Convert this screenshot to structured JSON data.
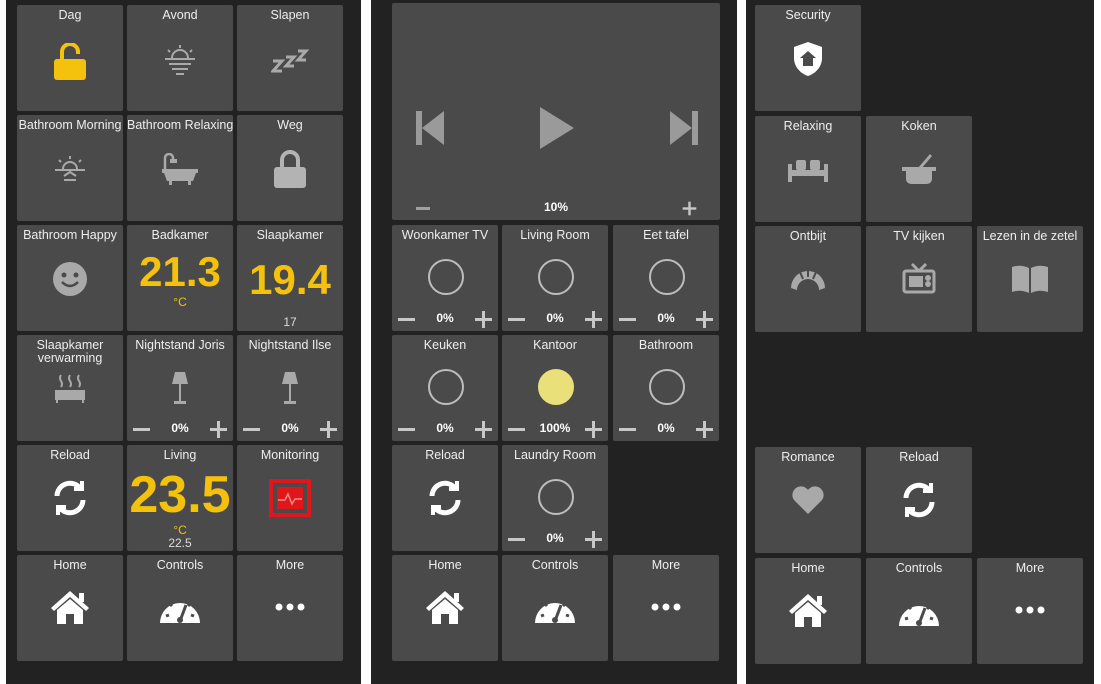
{
  "colors": {
    "accent": "#f4c20d",
    "alert": "#e0171a",
    "bulb_on": "#e9e07a",
    "tile": "#4a4a4a",
    "panel": "#222222"
  },
  "panel1": {
    "tiles": [
      {
        "label": "Dag",
        "icon": "unlock-icon"
      },
      {
        "label": "Avond",
        "icon": "sunset-icon"
      },
      {
        "label": "Slapen",
        "icon": "sleep-zzz-icon"
      },
      {
        "label": "Bathroom Morning",
        "icon": "sunrise-icon"
      },
      {
        "label": "Bathroom Relaxing",
        "icon": "bathtub-icon"
      },
      {
        "label": "Weg",
        "icon": "lock-icon"
      },
      {
        "label": "Bathroom Happy",
        "icon": "smiley-icon"
      },
      {
        "label": "Badkamer",
        "value": "21.3",
        "unit": "°C"
      },
      {
        "label": "Slaapkamer",
        "value": "19.4",
        "sub": "17"
      },
      {
        "label": "Slaapkamer verwarming",
        "icon": "radiator-icon"
      },
      {
        "label": "Nightstand Joris",
        "icon": "lamp-icon",
        "level": "0%"
      },
      {
        "label": "Nightstand Ilse",
        "icon": "lamp-icon",
        "level": "0%"
      },
      {
        "label": "Reload",
        "icon": "reload-icon"
      },
      {
        "label": "Living",
        "value": "23.5",
        "unit": "°C",
        "sub": "22.5"
      },
      {
        "label": "Monitoring",
        "icon": "monitoring-icon"
      },
      {
        "label": "Home",
        "icon": "home-icon"
      },
      {
        "label": "Controls",
        "icon": "gauge-icon"
      },
      {
        "label": "More",
        "icon": "more-icon"
      }
    ]
  },
  "panel2": {
    "media": {
      "volume": "10%"
    },
    "tiles": [
      {
        "label": "Woonkamer TV",
        "level": "0%"
      },
      {
        "label": "Living Room",
        "level": "0%"
      },
      {
        "label": "Eet tafel",
        "level": "0%"
      },
      {
        "label": "Keuken",
        "level": "0%"
      },
      {
        "label": "Kantoor",
        "level": "100%"
      },
      {
        "label": "Bathroom",
        "level": "0%"
      },
      {
        "label": "Reload",
        "icon": "reload-icon"
      },
      {
        "label": "Laundry Room",
        "level": "0%"
      },
      {
        "label": "Home",
        "icon": "home-icon"
      },
      {
        "label": "Controls",
        "icon": "gauge-icon"
      },
      {
        "label": "More",
        "icon": "more-icon"
      }
    ]
  },
  "panel3": {
    "tiles": [
      {
        "label": "Security",
        "icon": "shield-home-icon"
      },
      {
        "label": "Relaxing",
        "icon": "sofa-icon"
      },
      {
        "label": "Koken",
        "icon": "cooking-pot-icon"
      },
      {
        "label": "Ontbijt",
        "icon": "croissant-icon"
      },
      {
        "label": "TV kijken",
        "icon": "tv-icon"
      },
      {
        "label": "Lezen in de zetel",
        "icon": "book-icon"
      },
      {
        "label": "Romance",
        "icon": "heart-icon"
      },
      {
        "label": "Reload",
        "icon": "reload-icon"
      },
      {
        "label": "Home",
        "icon": "home-icon"
      },
      {
        "label": "Controls",
        "icon": "gauge-icon"
      },
      {
        "label": "More",
        "icon": "more-icon"
      }
    ]
  }
}
